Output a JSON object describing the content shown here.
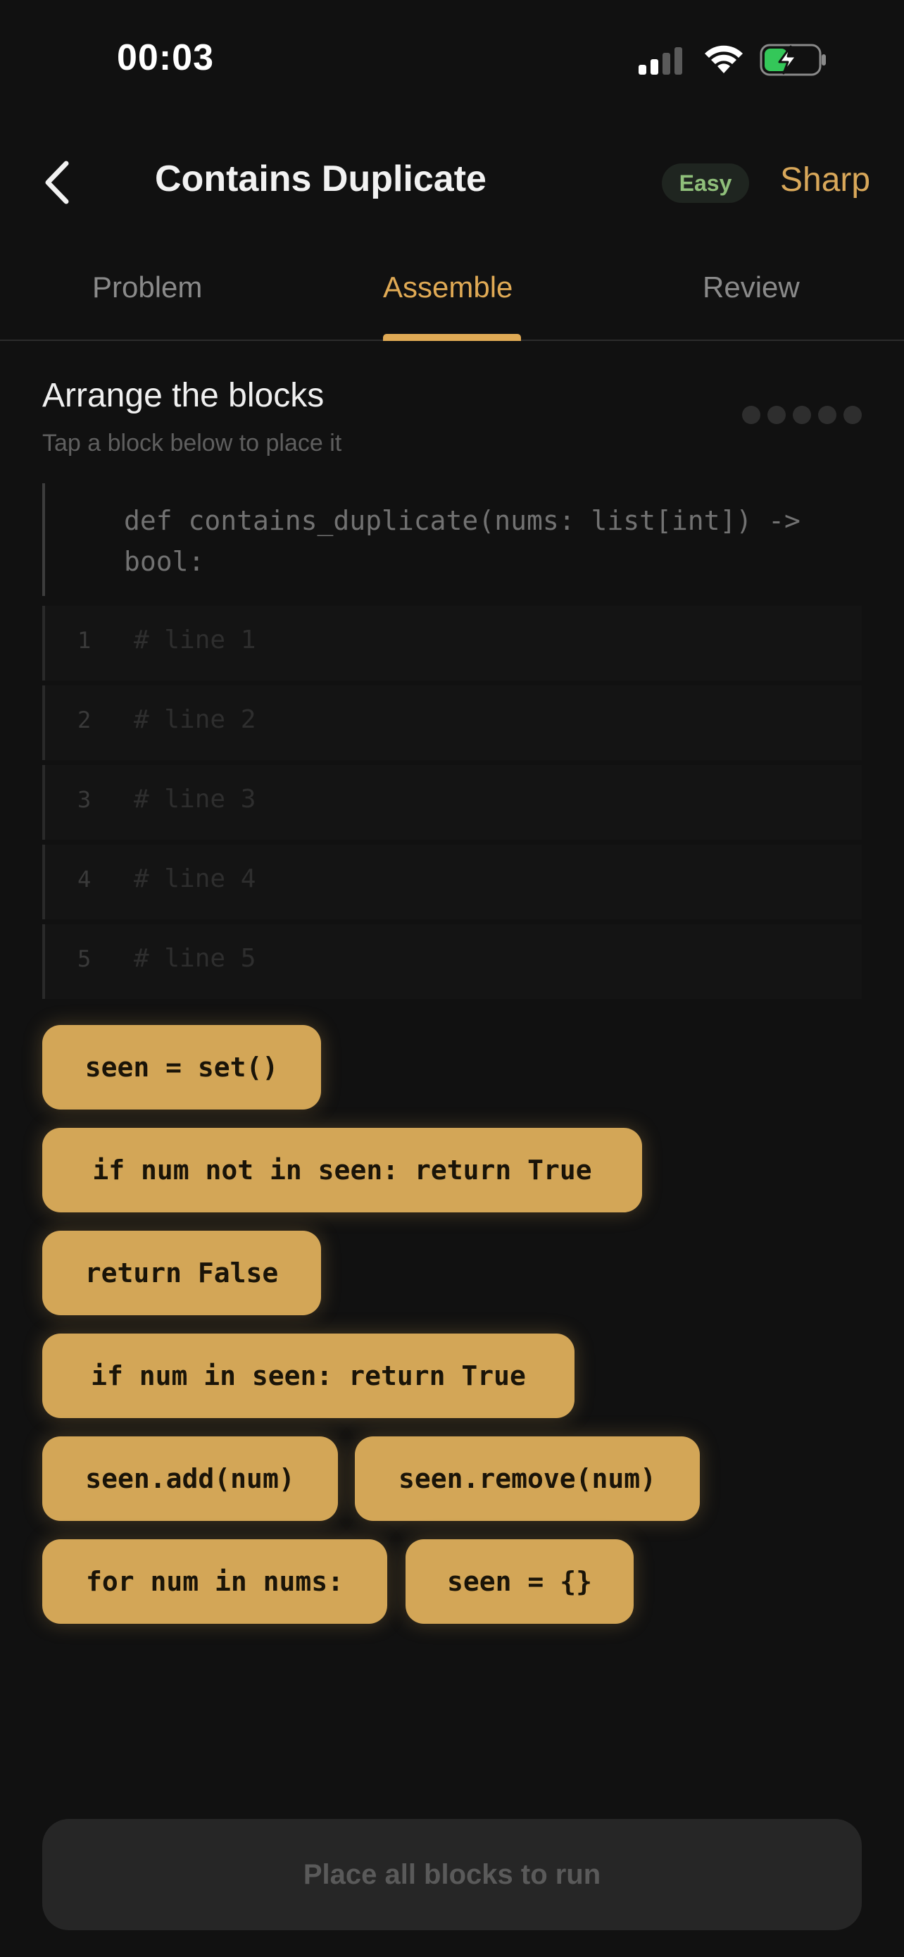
{
  "status_bar": {
    "time": "00:03",
    "icons": [
      "cellular-signal-icon",
      "wifi-icon",
      "battery-charging-icon"
    ]
  },
  "header": {
    "title": "Contains Duplicate",
    "difficulty": "Easy",
    "mode": "Sharp",
    "back_icon": "chevron-left-icon"
  },
  "tabs": [
    {
      "label": "Problem",
      "active": false
    },
    {
      "label": "Assemble",
      "active": true
    },
    {
      "label": "Review",
      "active": false
    }
  ],
  "section": {
    "title": "Arrange the blocks",
    "subtitle": "Tap a block below to place it",
    "progress_total": 5,
    "progress_filled": 0
  },
  "code": {
    "signature": "def contains_duplicate(nums: list[int]) -> bool:",
    "lines": [
      {
        "number": "1",
        "placeholder": "# line 1"
      },
      {
        "number": "2",
        "placeholder": "# line 2"
      },
      {
        "number": "3",
        "placeholder": "# line 3"
      },
      {
        "number": "4",
        "placeholder": "# line 4"
      },
      {
        "number": "5",
        "placeholder": "# line 5"
      }
    ]
  },
  "blocks": [
    "seen = set()",
    "if num not in seen: return True",
    "return False",
    "if num in seen: return True",
    "seen.add(num)",
    "seen.remove(num)",
    "for num in nums:",
    "seen = {}"
  ],
  "run_button": {
    "label": "Place all blocks to run"
  },
  "colors": {
    "accent": "#e0aa55",
    "block": "#d3a657",
    "background": "#111111",
    "easy_badge_text": "#8fbf7a"
  }
}
